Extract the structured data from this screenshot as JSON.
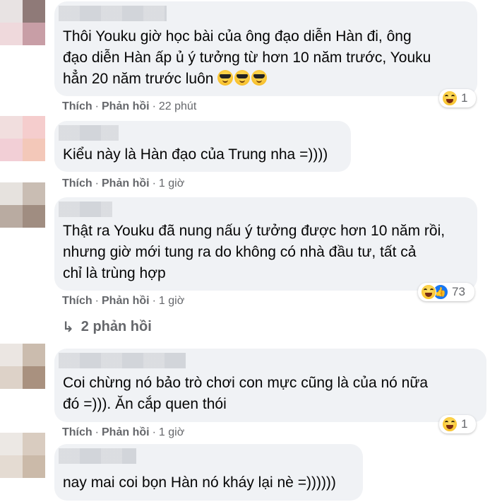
{
  "colors": {
    "bubble_bg": "#f0f2f5",
    "meta_text": "#65676b",
    "like_blue": "#1877f2"
  },
  "comments": [
    {
      "text": "Thôi Youku giờ học bài của ông đạo diễn Hàn đi, ông\nđạo diễn Hàn ấp ủ ý tưởng từ hơn 10 năm trước, Youku\nhẳn 20 năm trước luôn ",
      "emojis": [
        "sunglasses-emoji",
        "sunglasses-emoji",
        "sunglasses-emoji"
      ],
      "like_label": "Thích",
      "reply_label": "Phản hồi",
      "time": "22 phút",
      "reactions": {
        "icons": [
          "haha-icon"
        ],
        "count": "1"
      }
    },
    {
      "text": "Kiểu này là Hàn đạo của Trung nha =))))",
      "like_label": "Thích",
      "reply_label": "Phản hồi",
      "time": "1 giờ"
    },
    {
      "text": "Thật ra Youku đã nung nấu ý tưởng được hơn 10 năm rồi,\nnhưng giờ mới tung ra do không có nhà đầu tư, tất cả\nchỉ là trùng hợp",
      "like_label": "Thích",
      "reply_label": "Phản hồi",
      "time": "1 giờ",
      "reactions": {
        "icons": [
          "haha-icon",
          "like-icon"
        ],
        "count": "73"
      },
      "replies_label": "2 phản hồi"
    },
    {
      "text": "Coi chừng nó bảo trò chơi con mực cũng là của nó nữa\nđó =))). Ăn cắp quen thói",
      "like_label": "Thích",
      "reply_label": "Phản hồi",
      "time": "1 giờ",
      "reactions": {
        "icons": [
          "haha-icon"
        ],
        "count": "1"
      }
    },
    {
      "text": "nay mai coi bọn Hàn nó kháy lại nè =))))))"
    }
  ]
}
